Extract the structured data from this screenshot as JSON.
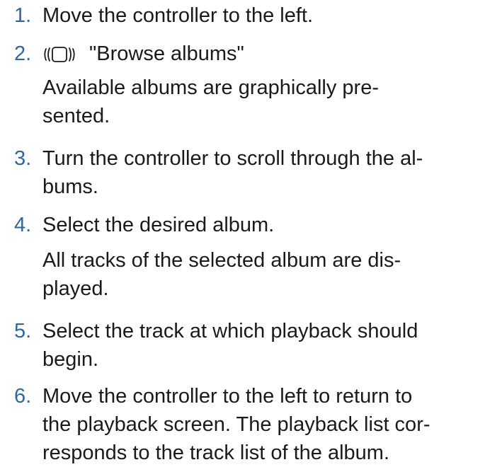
{
  "steps": [
    {
      "number": "1.",
      "lines": [
        "Move the controller to the left."
      ]
    },
    {
      "number": "2.",
      "icon": "controller-press-icon",
      "lines": [
        "\"Browse albums\""
      ],
      "result_lines": [
        "Available albums are graphically pre-",
        "sented."
      ]
    },
    {
      "number": "3.",
      "lines": [
        "Turn the controller to scroll through the al-",
        "bums."
      ]
    },
    {
      "number": "4.",
      "lines": [
        "Select the desired album."
      ],
      "result_lines": [
        "All tracks of the selected album are dis-",
        "played."
      ]
    },
    {
      "number": "5.",
      "lines": [
        "Select the track at which playback should",
        "begin."
      ]
    },
    {
      "number": "6.",
      "lines": [
        "Move the controller to the left to return to",
        "the playback screen. The playback list cor-",
        "responds to the track list of the album."
      ]
    }
  ],
  "colors": {
    "step_number": "#2a68a8",
    "text": "#1a1a1a"
  }
}
